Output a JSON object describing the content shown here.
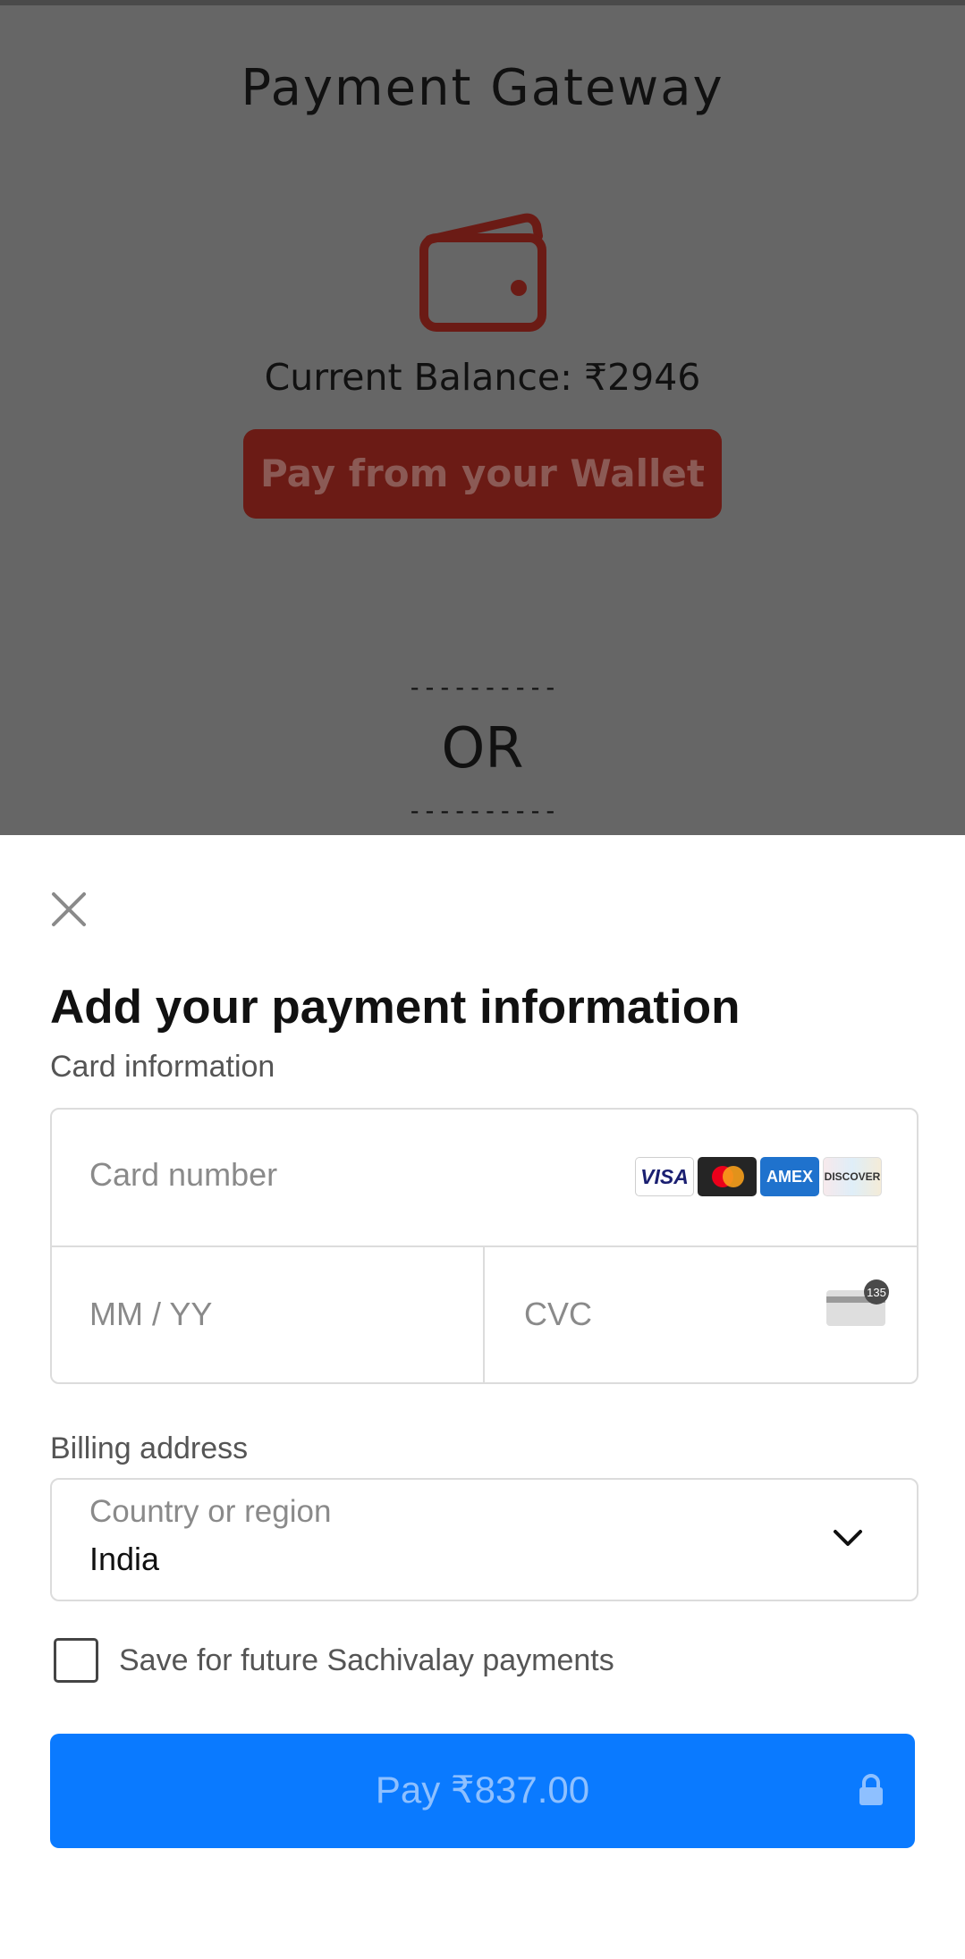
{
  "background": {
    "title": "Payment Gateway",
    "wallet_icon": "wallet-icon",
    "balance_text": "Current Balance: ₹2946",
    "wallet_button_label": "Pay from your Wallet",
    "divider_dashes": "----------",
    "or_text": "OR"
  },
  "sheet": {
    "close_icon": "close-icon",
    "title": "Add your payment information",
    "card_section_label": "Card information",
    "card_number_placeholder": "Card number",
    "card_brands": [
      "VISA",
      "Mastercard",
      "AMEX",
      "DISCOVER"
    ],
    "expiry_placeholder": "MM / YY",
    "cvc_placeholder": "CVC",
    "cvc_icon_badge": "135",
    "billing_section_label": "Billing address",
    "country_label": "Country or region",
    "country_value": "India",
    "save_label": "Save for future Sachivalay payments",
    "save_checked": false,
    "pay_button_label": "Pay ₹837.00"
  },
  "colors": {
    "overlay": "#666666",
    "wallet_accent": "#6b1b15",
    "pay_button": "#0a7aff"
  }
}
